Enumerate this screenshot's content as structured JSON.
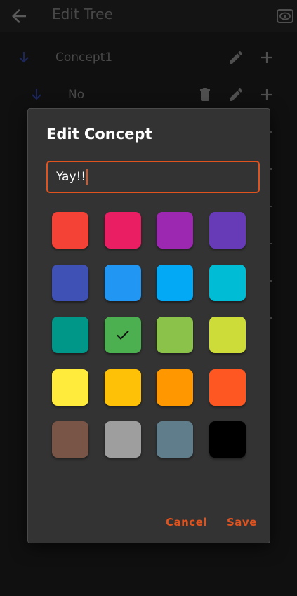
{
  "header": {
    "title": "Edit Tree",
    "back_icon": "arrow-left-icon",
    "preview_icon": "eye-icon"
  },
  "tree": {
    "rows": [
      {
        "label": "Concept1",
        "icons": [
          "arrow-down-icon",
          "pencil-icon",
          "plus-icon"
        ]
      },
      {
        "label": "No",
        "icons": [
          "arrow-down-icon",
          "trash-icon",
          "pencil-icon",
          "plus-icon"
        ]
      }
    ]
  },
  "dialog": {
    "title": "Edit Concept",
    "name_value": "Yay!!",
    "selected_color_index": 9,
    "colors": [
      "#F44336",
      "#E91E63",
      "#9C27B0",
      "#673AB7",
      "#3F51B5",
      "#2196F3",
      "#03A9F4",
      "#00BCD4",
      "#009688",
      "#4CAF50",
      "#8BC34A",
      "#CDDC39",
      "#FFEB3B",
      "#FFC107",
      "#FF9800",
      "#FF5722",
      "#795548",
      "#9E9E9E",
      "#607D8B",
      "#000000"
    ],
    "cancel_label": "Cancel",
    "save_label": "Save",
    "accent": "#E0521E"
  }
}
